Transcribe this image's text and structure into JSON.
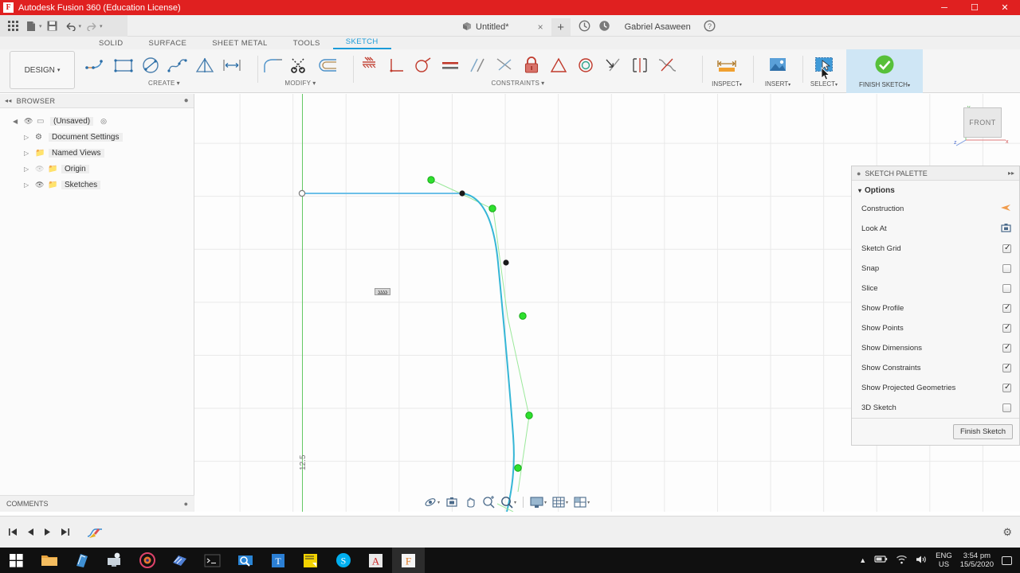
{
  "window": {
    "title": "Autodesk Fusion 360 (Education License)",
    "logo_letter": "F",
    "minimize": "─",
    "maximize": "☐",
    "close": "✕",
    "brand_color": "#e02020"
  },
  "quick_access": {
    "items": [
      {
        "name": "app-grid-icon",
        "glyph": "☷"
      },
      {
        "name": "file-icon",
        "glyph": "☰"
      },
      {
        "name": "save-icon",
        "glyph": "ὋE"
      },
      {
        "name": "undo-icon",
        "glyph": "↶"
      },
      {
        "name": "redo-icon",
        "glyph": "↷"
      }
    ]
  },
  "doc_tab": {
    "label": "Untitled*",
    "close": "×",
    "plus": "+"
  },
  "account": {
    "username": "Gabriel Asaween",
    "help": "?"
  },
  "ribbon": {
    "design_label": "DESIGN",
    "caret": "▾",
    "tabs": [
      {
        "label": "SOLID",
        "active": false
      },
      {
        "label": "SURFACE",
        "active": false
      },
      {
        "label": "SHEET METAL",
        "active": false
      },
      {
        "label": "TOOLS",
        "active": false
      },
      {
        "label": "SKETCH",
        "active": true
      }
    ],
    "panels": [
      {
        "label": "CREATE",
        "tools": [
          "line",
          "rectangle",
          "circle",
          "spline",
          "mirror",
          "dimension"
        ]
      },
      {
        "label": "MODIFY",
        "tools": [
          "fillet",
          "trim",
          "offset"
        ]
      },
      {
        "label": "CONSTRAINTS",
        "tools": [
          "horizontal-vertical",
          "perpendicular",
          "tangent",
          "equal",
          "parallel",
          "midpoint",
          "fix",
          "symmetry",
          "concentric",
          "collinear",
          "curvature",
          "smooth"
        ]
      }
    ],
    "inspect_label": "INSPECT",
    "insert_label": "INSERT",
    "select_label": "SELECT",
    "finish_sketch_label": "FINISH SKETCH",
    "active_tab_color": "#1b9bd8",
    "finish_bg": "#cfe6f5"
  },
  "browser": {
    "title": "BROWSER",
    "collapse": "◂◂",
    "items": [
      {
        "label": "(Unsaved)",
        "depth": 0,
        "has_eye": true,
        "has_folder": false
      },
      {
        "label": "Document Settings",
        "depth": 1,
        "has_eye": false,
        "has_folder": true
      },
      {
        "label": "Named Views",
        "depth": 1,
        "has_eye": false,
        "has_folder": true
      },
      {
        "label": "Origin",
        "depth": 1,
        "has_eye": true,
        "has_folder": true
      },
      {
        "label": "Sketches",
        "depth": 1,
        "has_eye": true,
        "has_folder": true
      }
    ],
    "comments_label": "COMMENTS"
  },
  "canvas": {
    "viewcube_face": "FRONT",
    "axis_x_label": "x",
    "axis_y_label": "y",
    "axis_z_label": "z",
    "dimension_text": "12.5",
    "sketch_line_color": "#6cc0e8",
    "spline_color": "#3cb878",
    "control_point_color": "#2ee02e",
    "grid_color": "#e9e9e9",
    "axis_color": "#64c864"
  },
  "palette": {
    "title": "SKETCH PALETTE",
    "expand": "▸▸",
    "section_label": "Options",
    "section_caret": "▾",
    "options": [
      {
        "label": "Construction",
        "type": "icon",
        "icon": "construction-icon",
        "checked": false
      },
      {
        "label": "Look At",
        "type": "icon",
        "icon": "look-at-icon",
        "checked": false
      },
      {
        "label": "Sketch Grid",
        "type": "checkbox",
        "checked": true
      },
      {
        "label": "Snap",
        "type": "checkbox",
        "checked": false
      },
      {
        "label": "Slice",
        "type": "checkbox",
        "checked": false
      },
      {
        "label": "Show Profile",
        "type": "checkbox",
        "checked": true
      },
      {
        "label": "Show Points",
        "type": "checkbox",
        "checked": true
      },
      {
        "label": "Show Dimensions",
        "type": "checkbox",
        "checked": true
      },
      {
        "label": "Show Constraints",
        "type": "checkbox",
        "checked": true
      },
      {
        "label": "Show Projected Geometries",
        "type": "checkbox",
        "checked": true
      },
      {
        "label": "3D Sketch",
        "type": "checkbox",
        "checked": false
      }
    ],
    "finish_button": "Finish Sketch"
  },
  "navbar": {
    "items": [
      {
        "name": "orbit-icon",
        "caret": true
      },
      {
        "name": "look-at-icon",
        "caret": false
      },
      {
        "name": "pan-icon",
        "caret": false
      },
      {
        "name": "zoom-icon",
        "caret": false
      },
      {
        "name": "zoom-window-icon",
        "caret": true
      },
      {
        "name": "display-settings-icon",
        "caret": true
      },
      {
        "name": "grid-snap-icon",
        "caret": true
      },
      {
        "name": "viewports-icon",
        "caret": true
      }
    ]
  },
  "timeline": {
    "buttons": [
      "⏮",
      "⏴",
      "⏵",
      "⏭"
    ],
    "settings_icon": "gear-icon"
  },
  "taskbar": {
    "start": "start-button",
    "apps": [
      {
        "name": "file-explorer",
        "color": "#e8a33d",
        "letter": ""
      },
      {
        "name": "store-app",
        "color": "#3f8fd2",
        "letter": ""
      },
      {
        "name": "monitor-app",
        "color": "#c9d3dc",
        "letter": ""
      },
      {
        "name": "media-app",
        "color": "#e0436a",
        "letter": ""
      },
      {
        "name": "notes-app",
        "color": "#4f7fd4",
        "letter": ""
      },
      {
        "name": "terminal-app",
        "color": "#1b1b1b",
        "letter": ""
      },
      {
        "name": "search-app",
        "color": "#2a85d6",
        "letter": ""
      },
      {
        "name": "text-app",
        "color": "#2b7fd4",
        "letter": "T"
      },
      {
        "name": "notepad-app",
        "color": "#f2d200",
        "letter": ""
      },
      {
        "name": "skype-app",
        "color": "#00aff0",
        "letter": "S"
      },
      {
        "name": "autocad-app",
        "color": "#e8e8e8",
        "letter": "A"
      },
      {
        "name": "fusion-app",
        "color": "#f5f5f5",
        "letter": "F"
      }
    ],
    "tray": {
      "language_line1": "ENG",
      "language_line2": "US",
      "time": "3:54 pm",
      "date": "15/5/2020"
    }
  }
}
